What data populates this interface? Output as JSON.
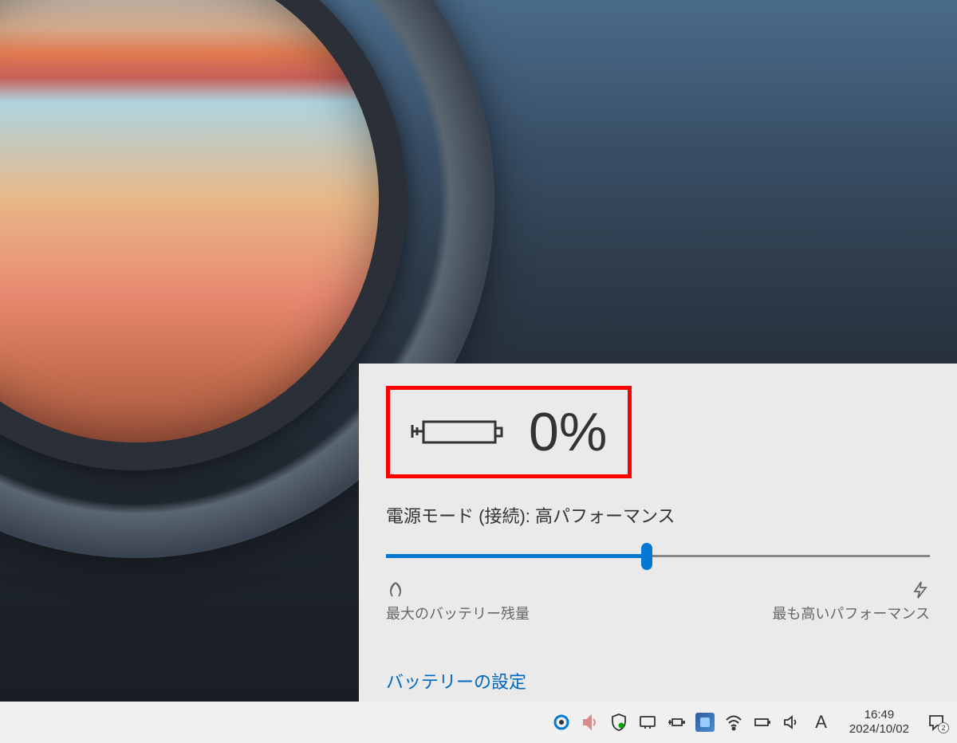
{
  "battery_flyout": {
    "percent": "0%",
    "power_mode_label": "電源モード (接続): 高パフォーマンス",
    "slider": {
      "min_label": "最大のバッテリー残量",
      "max_label": "最も高いパフォーマンス",
      "position_percent": 48
    },
    "settings_link": "バッテリーの設定"
  },
  "taskbar": {
    "time": "16:49",
    "date": "2024/10/02",
    "ime": "A",
    "notification_count": "2"
  }
}
